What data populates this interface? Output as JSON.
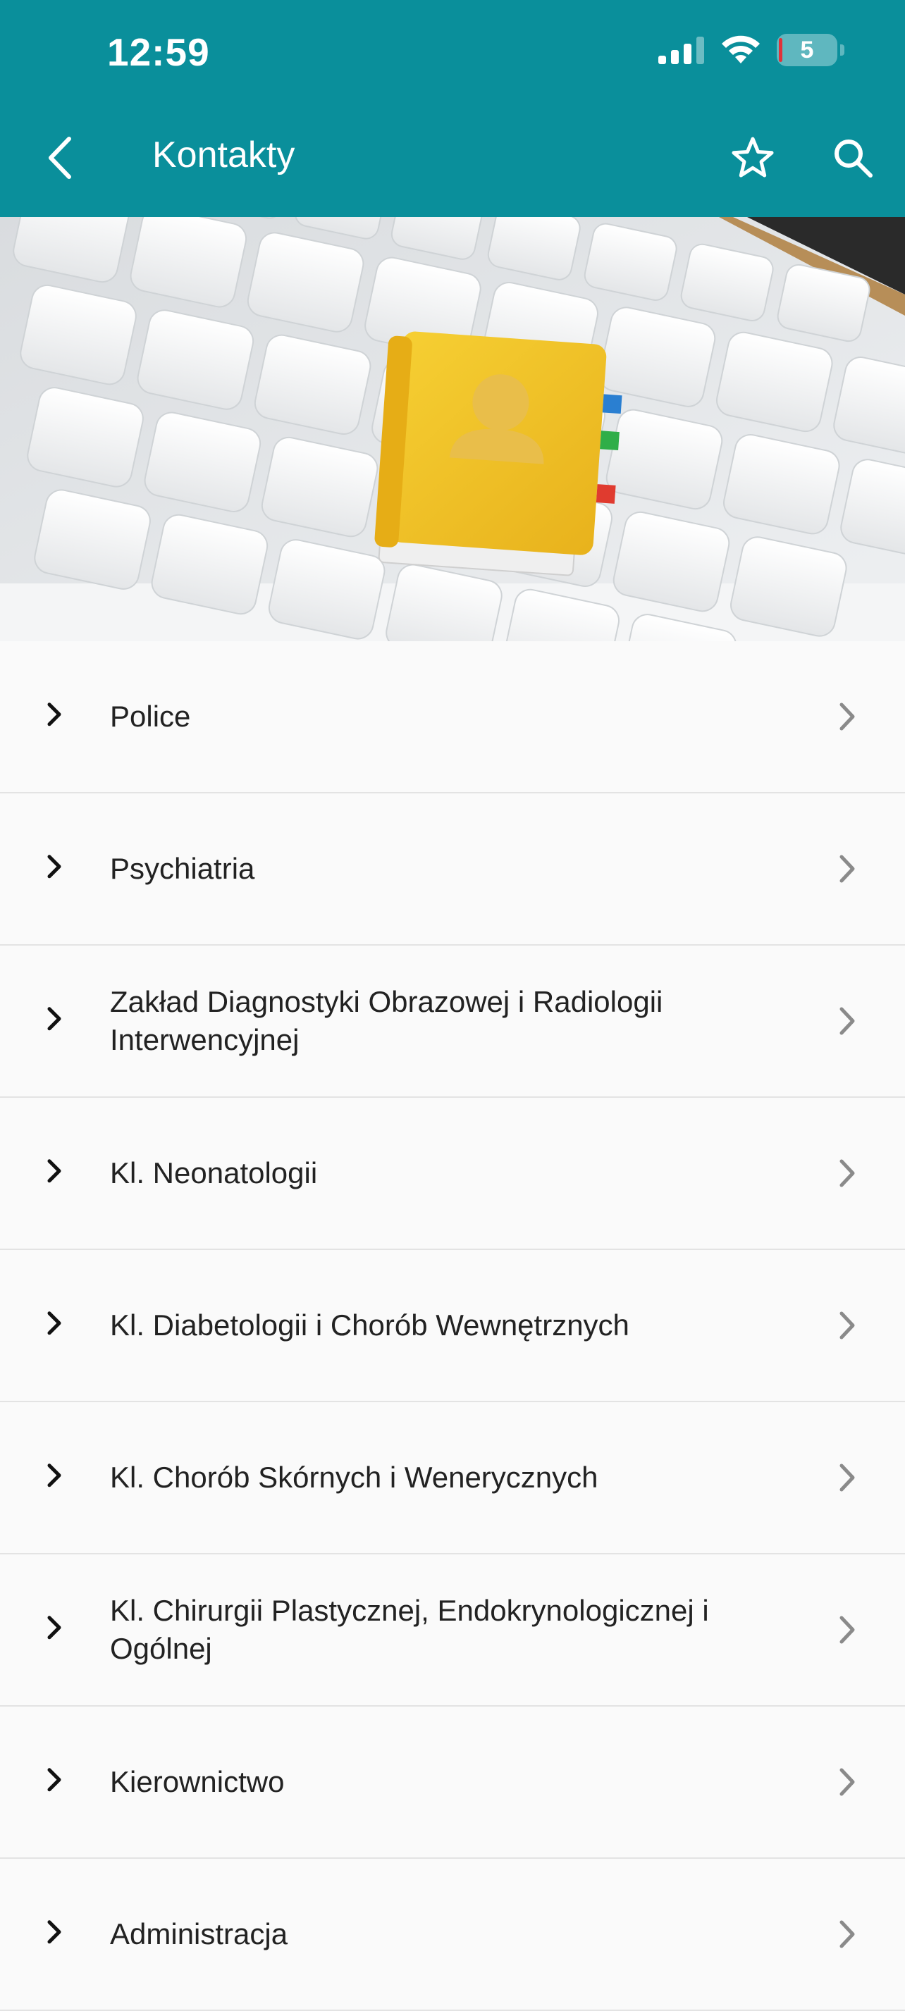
{
  "status_bar": {
    "time": "12:59",
    "battery_level": "5"
  },
  "nav": {
    "title": "Kontakty",
    "icons": [
      "back-arrow-icon",
      "star-icon",
      "search-icon"
    ]
  },
  "hero": {
    "icon": "contact-book-on-keyboard-image"
  },
  "colors": {
    "header": "#0a8f9b",
    "background": "#fafafa",
    "divider": "#e3e3e3",
    "text": "#222222",
    "chevron": "#8a8a8a"
  },
  "list": {
    "items": [
      {
        "label": "Police"
      },
      {
        "label": "Psychiatria"
      },
      {
        "label": "Zakład Diagnostyki Obrazowej i Radiologii Interwencyjnej"
      },
      {
        "label": "Kl. Neonatologii"
      },
      {
        "label": "Kl. Diabetologii i Chorób Wewnętrznych"
      },
      {
        "label": "Kl. Chorób Skórnych i Wenerycznych"
      },
      {
        "label": "Kl. Chirurgii Plastycznej, Endokrynologicznej i Ogólnej"
      },
      {
        "label": "Kierownictwo"
      },
      {
        "label": "Administracja"
      }
    ]
  }
}
